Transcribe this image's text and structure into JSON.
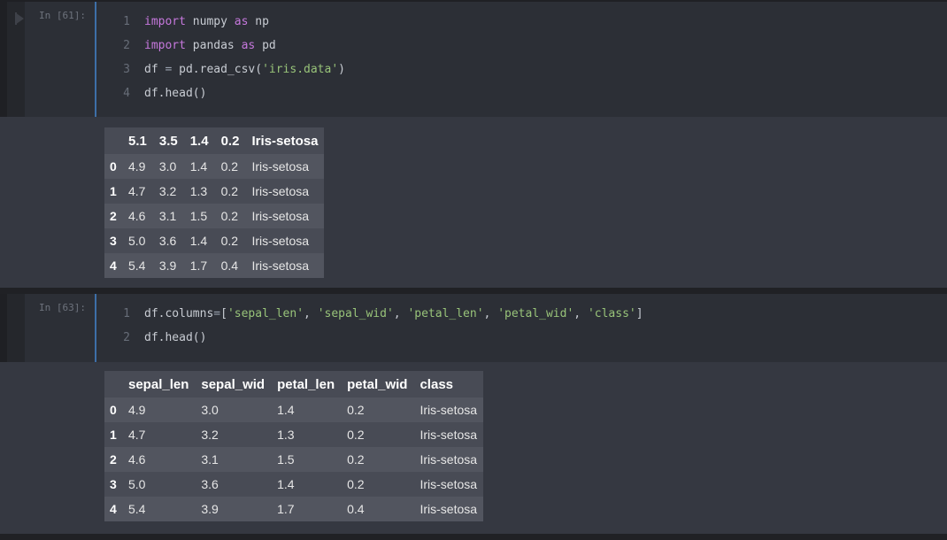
{
  "cells": [
    {
      "prompt": "In  [61]:",
      "lines": [
        {
          "n": "1",
          "segments": [
            {
              "t": "import",
              "c": "kw"
            },
            {
              "t": " numpy ",
              "c": ""
            },
            {
              "t": "as",
              "c": "kw"
            },
            {
              "t": " np",
              "c": ""
            }
          ]
        },
        {
          "n": "2",
          "segments": [
            {
              "t": "import",
              "c": "kw"
            },
            {
              "t": " pandas ",
              "c": ""
            },
            {
              "t": "as",
              "c": "kw"
            },
            {
              "t": " pd",
              "c": ""
            }
          ]
        },
        {
          "n": "3",
          "segments": [
            {
              "t": "df ",
              "c": ""
            },
            {
              "t": "=",
              "c": "op"
            },
            {
              "t": " pd.read_csv(",
              "c": ""
            },
            {
              "t": "'iris.data'",
              "c": "str"
            },
            {
              "t": ")",
              "c": ""
            }
          ]
        },
        {
          "n": "4",
          "segments": [
            {
              "t": "df.head()",
              "c": ""
            }
          ]
        }
      ],
      "output": {
        "columns": [
          "",
          "5.1",
          "3.5",
          "1.4",
          "0.2",
          "Iris-setosa"
        ],
        "rows": [
          [
            "0",
            "4.9",
            "3.0",
            "1.4",
            "0.2",
            "Iris-setosa"
          ],
          [
            "1",
            "4.7",
            "3.2",
            "1.3",
            "0.2",
            "Iris-setosa"
          ],
          [
            "2",
            "4.6",
            "3.1",
            "1.5",
            "0.2",
            "Iris-setosa"
          ],
          [
            "3",
            "5.0",
            "3.6",
            "1.4",
            "0.2",
            "Iris-setosa"
          ],
          [
            "4",
            "5.4",
            "3.9",
            "1.7",
            "0.4",
            "Iris-setosa"
          ]
        ]
      }
    },
    {
      "prompt": "In  [63]:",
      "lines": [
        {
          "n": "1",
          "segments": [
            {
              "t": "df.columns",
              "c": ""
            },
            {
              "t": "=",
              "c": "op"
            },
            {
              "t": "[",
              "c": ""
            },
            {
              "t": "'sepal_len'",
              "c": "str"
            },
            {
              "t": ", ",
              "c": ""
            },
            {
              "t": "'sepal_wid'",
              "c": "str"
            },
            {
              "t": ", ",
              "c": ""
            },
            {
              "t": "'petal_len'",
              "c": "str"
            },
            {
              "t": ", ",
              "c": ""
            },
            {
              "t": "'petal_wid'",
              "c": "str"
            },
            {
              "t": ", ",
              "c": ""
            },
            {
              "t": "'class'",
              "c": "str"
            },
            {
              "t": "]",
              "c": ""
            }
          ]
        },
        {
          "n": "2",
          "segments": [
            {
              "t": "df.head()",
              "c": ""
            }
          ]
        }
      ],
      "output": {
        "columns": [
          "",
          "sepal_len",
          "sepal_wid",
          "petal_len",
          "petal_wid",
          "class"
        ],
        "rows": [
          [
            "0",
            "4.9",
            "3.0",
            "1.4",
            "0.2",
            "Iris-setosa"
          ],
          [
            "1",
            "4.7",
            "3.2",
            "1.3",
            "0.2",
            "Iris-setosa"
          ],
          [
            "2",
            "4.6",
            "3.1",
            "1.5",
            "0.2",
            "Iris-setosa"
          ],
          [
            "3",
            "5.0",
            "3.6",
            "1.4",
            "0.2",
            "Iris-setosa"
          ],
          [
            "4",
            "5.4",
            "3.9",
            "1.7",
            "0.4",
            "Iris-setosa"
          ]
        ]
      }
    }
  ],
  "colors": {
    "keyword": "#c678dd",
    "string": "#98c379",
    "editor_bg": "#2c2f36",
    "output_bg": "#353841",
    "active_border": "#3d6fa8"
  },
  "icons": {
    "run": "run-cell-icon"
  }
}
